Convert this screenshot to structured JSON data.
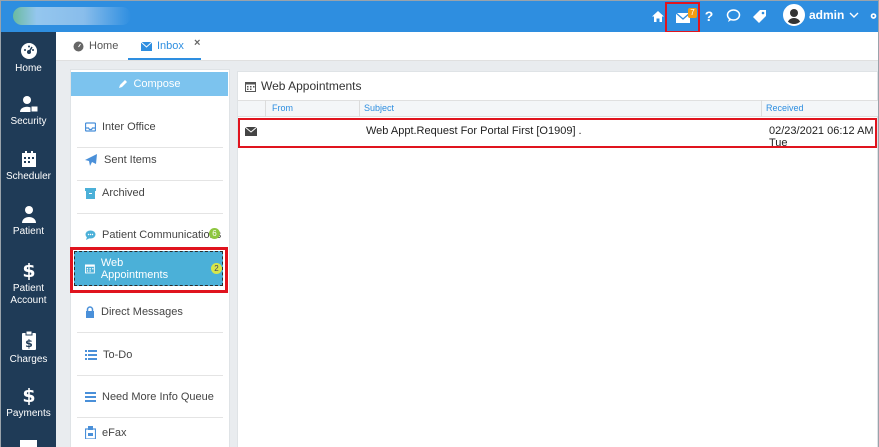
{
  "topbar": {
    "notification_count": "7",
    "help_label": "?",
    "user_name": "admin"
  },
  "leftnav": [
    {
      "label": "Home",
      "icon": "dashboard-icon"
    },
    {
      "label": "Security",
      "icon": "user-lock-icon"
    },
    {
      "label": "Scheduler",
      "icon": "calendar-icon"
    },
    {
      "label": "Patient",
      "icon": "person-icon"
    },
    {
      "label": "Patient",
      "label2": "Account",
      "icon": "dollar-icon"
    },
    {
      "label": "Charges",
      "icon": "clipboard-dollar-icon"
    },
    {
      "label": "Payments",
      "icon": "dollar-icon"
    }
  ],
  "tabs": [
    {
      "label": "Home"
    },
    {
      "label": "Inbox"
    }
  ],
  "tab_close": "×",
  "compose_label": "Compose",
  "folders": [
    {
      "label": "Inter Office"
    },
    {
      "label": "Sent Items"
    },
    {
      "label": "Archived"
    },
    {
      "label": "Patient Communications",
      "badge": "6"
    },
    {
      "label": "Web Appointments",
      "badge": "2"
    },
    {
      "label": "Direct Messages"
    },
    {
      "label": "To-Do"
    },
    {
      "label": "Need More Info Queue"
    },
    {
      "label": "eFax"
    }
  ],
  "list": {
    "title": "Web Appointments",
    "columns": [
      "From",
      "Subject",
      "Received"
    ],
    "rows": [
      {
        "from": "",
        "subject": "Web Appt.Request For Portal First [O1909] .",
        "received": "02/23/2021 06:12 AM Tue"
      }
    ]
  },
  "colors": {
    "topbar": "#2e8ee0",
    "leftnav": "#1f3b57",
    "highlight": "#e0141e",
    "selected_folder": "#4bb0d8"
  }
}
